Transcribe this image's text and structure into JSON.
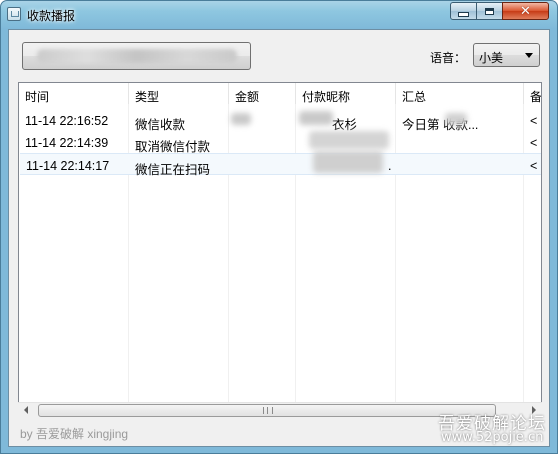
{
  "window": {
    "title": "收款播报",
    "icon": "app-window-icon",
    "controls": [
      "minimize-icon",
      "maximize-icon",
      "close-icon"
    ],
    "close_glyph": "✕"
  },
  "toolbar": {
    "blurred_button_label": ""
  },
  "language": {
    "label": "语音：",
    "selected": "小美"
  },
  "table": {
    "columns": [
      "时间",
      "类型",
      "金额",
      "付款昵称",
      "汇总",
      "备"
    ],
    "rows": [
      {
        "time": "11-14 22:16:52",
        "type": "微信收款",
        "amount": "",
        "payer": "衣杉",
        "summary": "今日第   收款...",
        "extra": "<"
      },
      {
        "time": "11-14 22:14:39",
        "type": "取消微信付款",
        "amount": "",
        "payer": "",
        "summary": "",
        "extra": "<"
      },
      {
        "time": "11-14 22:14:17",
        "type": "微信正在扫码",
        "amount": "",
        "payer": "",
        "summary": ".",
        "extra": "<"
      }
    ]
  },
  "footer": {
    "credit": "by 吾爱破解 xingjing"
  },
  "watermark": {
    "line1": "吾爱破解论坛",
    "line2": "www.52pojie.cn"
  },
  "colors": {
    "frame": "#7fb9d9",
    "close_button": "#c73b16",
    "selection": "#f4f9fd",
    "client_bg": "#f0f0f0"
  }
}
